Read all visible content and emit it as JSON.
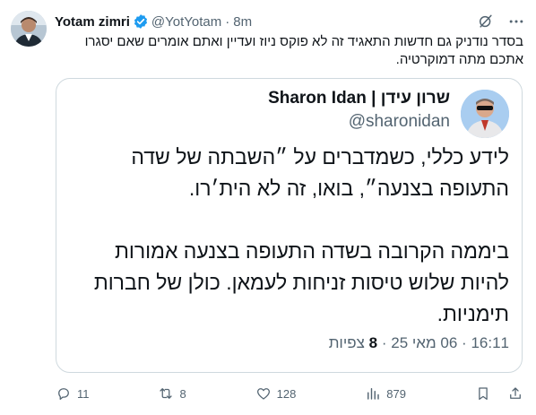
{
  "author": {
    "name": "Yotam zimri",
    "handle": "@YotYotam",
    "time": "8m",
    "separator": "·"
  },
  "tweet": {
    "text": "בסדר נודניק גם חדשות התאגיד זה לא פוקס ניוז ועדיין ואתם אומרים שאם יסגרו אתכם מתה דמוקרטיה."
  },
  "quote": {
    "name": "Sharon Idan | שרון עידן",
    "handle": "@sharonidan",
    "line1": "לידע כללי, כשמדברים על ״השבתה של שדה",
    "line2": "התעופה בצנעה״, בואו, זה לא הית׳רו.",
    "line3": "ביממה הקרובה בשדה התעופה בצנעה אמורות",
    "line4": "להיות שלוש טיסות זניחות לעמאן. כולן של חברות",
    "line5": "תימניות.",
    "time": "16:11",
    "date": "06 מאי 25",
    "views_count": "8",
    "views_label": "צפיות",
    "separator": "·"
  },
  "actions": {
    "replies": "11",
    "reposts": "8",
    "likes": "128",
    "views": "879"
  },
  "colors": {
    "text": "#0f1419",
    "muted": "#536471",
    "border": "#cfd9de",
    "verified": "#1d9bf0"
  },
  "icons": [
    "grok-icon",
    "more-icon",
    "verified-icon",
    "reply-icon",
    "repost-icon",
    "like-icon",
    "views-icon",
    "bookmark-icon",
    "share-icon"
  ]
}
